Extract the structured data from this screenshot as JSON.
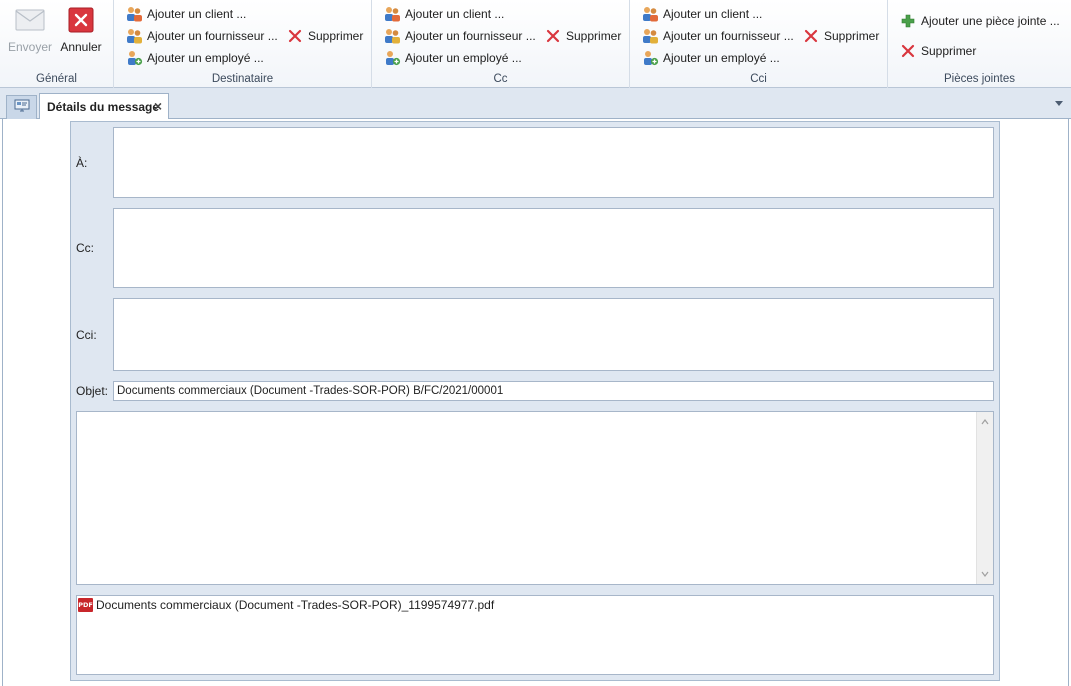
{
  "ribbon": {
    "general": {
      "caption": "Général",
      "send_label": "Envoyer",
      "cancel_label": "Annuler"
    },
    "to_group": {
      "caption": "Destinataire",
      "add_client": "Ajouter un client ...",
      "add_supplier": "Ajouter un fournisseur ...",
      "add_employee": "Ajouter un employé ...",
      "delete": "Supprimer"
    },
    "cc_group": {
      "caption": "Cc",
      "add_client": "Ajouter un client ...",
      "add_supplier": "Ajouter un fournisseur ...",
      "add_employee": "Ajouter un employé ...",
      "delete": "Supprimer"
    },
    "bcc_group": {
      "caption": "Cci",
      "add_client": "Ajouter un client ...",
      "add_supplier": "Ajouter un fournisseur ...",
      "add_employee": "Ajouter un employé ...",
      "delete": "Supprimer"
    },
    "attachments_group": {
      "caption": "Pièces jointes",
      "add_attachment": "Ajouter une pièce jointe ...",
      "delete": "Supprimer"
    }
  },
  "tabs": {
    "home_icon": "monitor-icon",
    "active_tab_label": "Détails du message"
  },
  "form": {
    "to_label": "À:",
    "cc_label": "Cc:",
    "bcc_label": "Cci:",
    "subject_label": "Objet:",
    "subject_value": "Documents commerciaux (Document -Trades-SOR-POR) B/FC/2021/00001",
    "attachments": [
      {
        "name": "Documents commerciaux (Document -Trades-SOR-POR)_1199574977.pdf",
        "icon": "pdf-icon"
      }
    ]
  },
  "colors": {
    "accent_red": "#d9363e",
    "panel_bg": "#dfe7f1",
    "ribbon_border": "#b9c6d6"
  }
}
